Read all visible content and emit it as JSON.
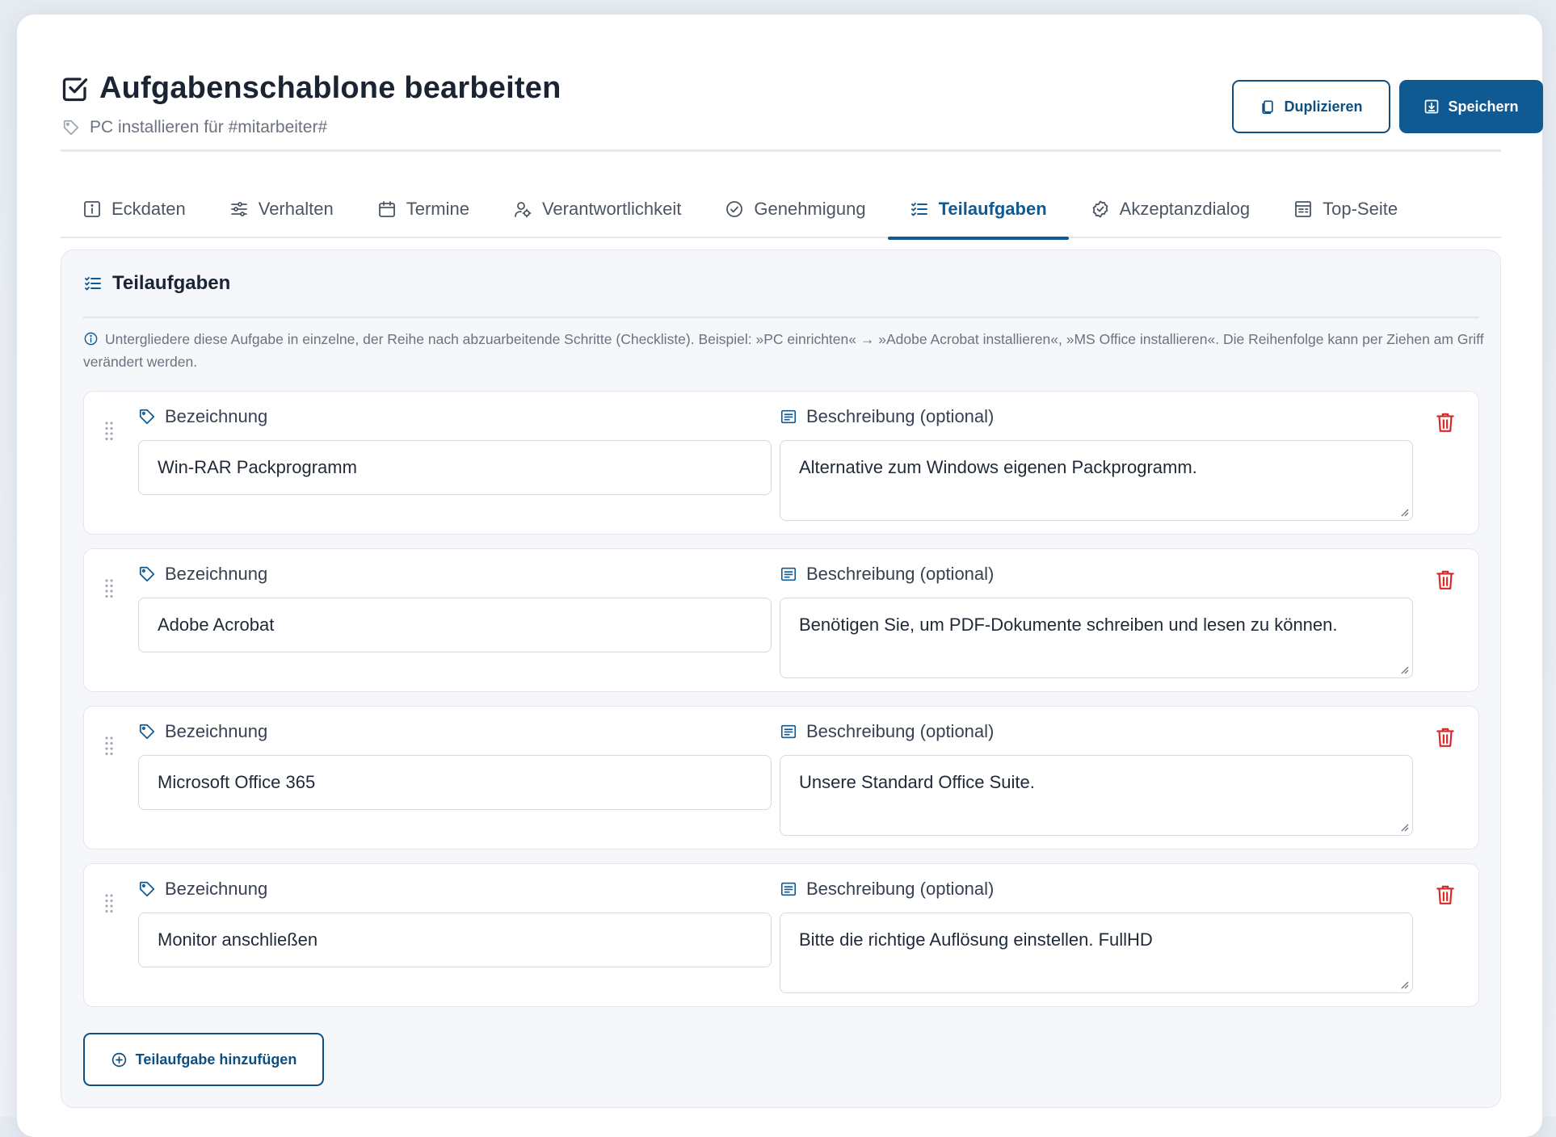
{
  "header": {
    "title": "Aufgabenschablone bearbeiten",
    "subtitle": "PC installieren für #mitarbeiter#",
    "duplicate_label": "Duplizieren",
    "save_label": "Speichern"
  },
  "tabs": [
    {
      "label": "Eckdaten",
      "icon": "info-icon"
    },
    {
      "label": "Verhalten",
      "icon": "sliders-icon"
    },
    {
      "label": "Termine",
      "icon": "calendar-icon"
    },
    {
      "label": "Verantwortlichkeit",
      "icon": "user-gear-icon"
    },
    {
      "label": "Genehmigung",
      "icon": "check-circle-icon"
    },
    {
      "label": "Teilaufgaben",
      "icon": "list-check-icon",
      "active": true
    },
    {
      "label": "Akzeptanzdialog",
      "icon": "badge-check-icon"
    },
    {
      "label": "Top-Seite",
      "icon": "layout-icon"
    }
  ],
  "panel": {
    "title": "Teilaufgaben",
    "hint": "Untergliedere diese Aufgabe in einzelne, der Reihe nach abzuarbeitende Schritte (Checkliste). Beispiel: »PC einrichten« → »Adobe Acrobat installieren«, »MS Office installieren«. Die Reihenfolge kann per Ziehen am Griff verändert werden.",
    "name_label": "Bezeichnung",
    "desc_label": "Beschreibung (optional)",
    "add_label": "Teilaufgabe hinzufügen"
  },
  "subtasks": [
    {
      "name": "Win-RAR Packprogramm",
      "description": "Alternative zum Windows eigenen Packprogramm."
    },
    {
      "name": "Adobe Acrobat",
      "description": "Benötigen Sie, um PDF-Dokumente schreiben und lesen zu können."
    },
    {
      "name": "Microsoft Office 365",
      "description": "Unsere Standard Office Suite."
    },
    {
      "name": "Monitor anschließen",
      "description": "Bitte die richtige Auflösung einstellen. FullHD"
    }
  ],
  "colors": {
    "accent": "#0f5a93",
    "danger": "#dc2626",
    "muted": "#6b7280"
  }
}
